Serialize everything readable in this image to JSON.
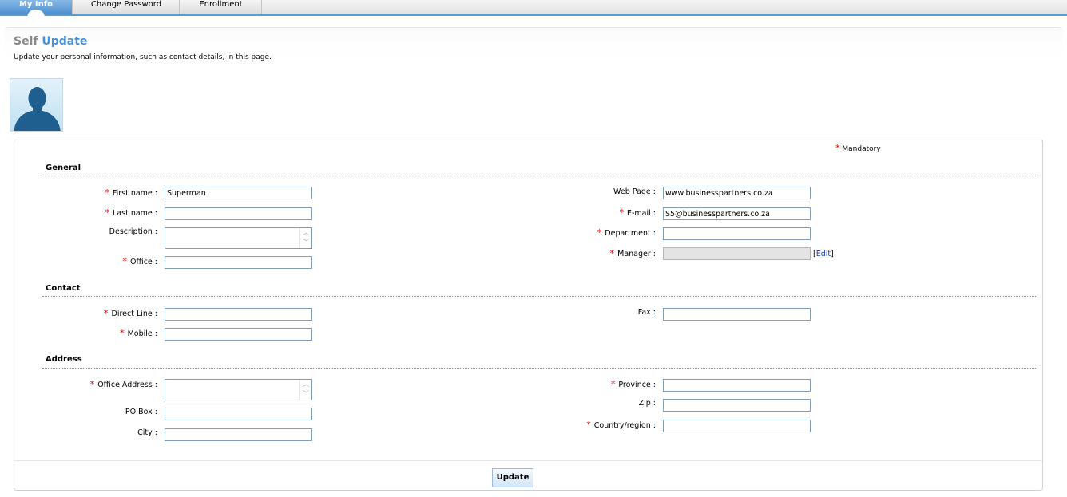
{
  "tabs": [
    {
      "label": "My Info",
      "active": true
    },
    {
      "label": "Change Password",
      "active": false
    },
    {
      "label": "Enrollment",
      "active": false
    }
  ],
  "header": {
    "title_word1": "Self",
    "title_word2": "Update",
    "subtitle": "Update your personal information, such as contact details, in this page."
  },
  "mandatory_label": "Mandatory",
  "required_marker": "*",
  "sections": {
    "general": "General",
    "contact": "Contact",
    "address": "Address"
  },
  "fields": {
    "first_name": {
      "label": "First name :",
      "value": "Superman",
      "required": true
    },
    "last_name": {
      "label": "Last name :",
      "value": "",
      "required": true
    },
    "description": {
      "label": "Description :",
      "value": "",
      "required": false
    },
    "office": {
      "label": "Office :",
      "value": "",
      "required": true
    },
    "web_page": {
      "label": "Web Page :",
      "value": "www.businesspartners.co.za",
      "required": false
    },
    "email": {
      "label": "E-mail :",
      "value": "S5@businesspartners.co.za",
      "required": true
    },
    "department": {
      "label": "Department :",
      "value": "",
      "required": true
    },
    "manager": {
      "label": "Manager :",
      "value": "",
      "required": true,
      "readonly": true
    },
    "direct_line": {
      "label": "Direct Line :",
      "value": "",
      "required": true
    },
    "mobile": {
      "label": "Mobile :",
      "value": "",
      "required": true
    },
    "fax": {
      "label": "Fax :",
      "value": "",
      "required": false
    },
    "office_address": {
      "label": "Office Address :",
      "value": "",
      "required": true
    },
    "po_box": {
      "label": "PO Box :",
      "value": "",
      "required": false
    },
    "city": {
      "label": "City :",
      "value": "",
      "required": false
    },
    "province": {
      "label": "Province :",
      "value": "",
      "required": true
    },
    "zip": {
      "label": "Zip :",
      "value": "",
      "required": false
    },
    "country": {
      "label": "Country/region :",
      "value": "",
      "required": true
    }
  },
  "manager_edit": {
    "open": "[",
    "link": "Edit",
    "close": "]"
  },
  "update_button": "Update",
  "colors": {
    "tab_active": "#4b8fd0",
    "title_accent": "#4a90d9",
    "required": "#d40000"
  }
}
